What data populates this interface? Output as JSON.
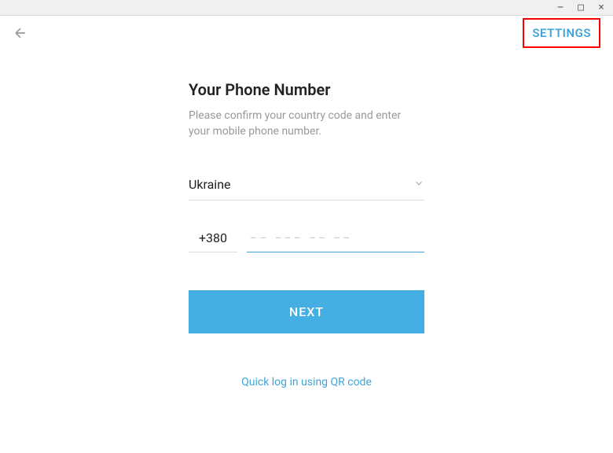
{
  "header": {
    "settings_label": "SETTINGS"
  },
  "main": {
    "title": "Your Phone Number",
    "subtitle": "Please confirm your country code and enter your mobile phone number.",
    "country": "Ukraine",
    "country_code": "+380",
    "phone_value": "",
    "phone_placeholder": "−− −−− −− −−",
    "next_label": "NEXT",
    "qr_link_label": "Quick log in using QR code"
  }
}
